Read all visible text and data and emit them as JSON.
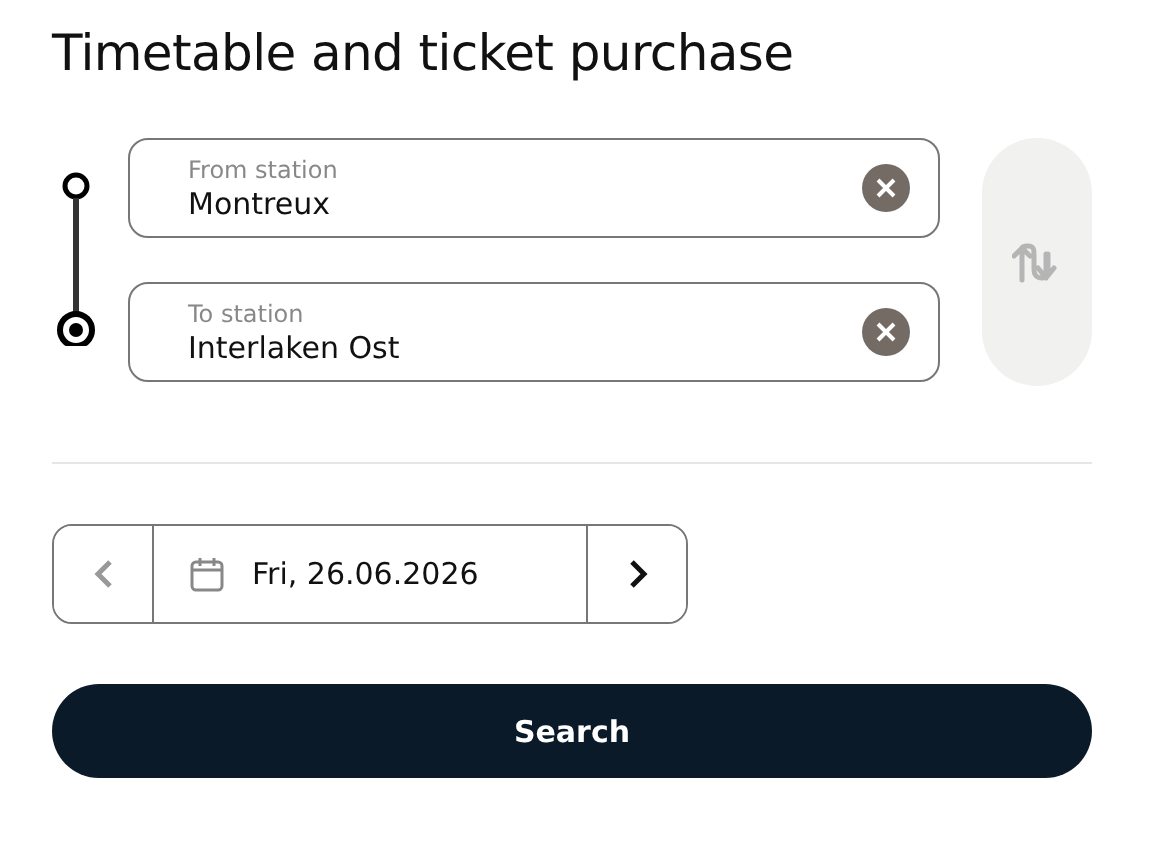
{
  "title": "Timetable and ticket purchase",
  "stations": [
    {
      "label": "From station",
      "value": "Montreux"
    },
    {
      "label": "To station",
      "value": "Interlaken Ost"
    }
  ],
  "swap": {
    "disabled": true
  },
  "date": {
    "value": "Fri, 26.06.2026",
    "previous_disabled": true,
    "next_disabled": false
  },
  "search_button": "Search"
}
